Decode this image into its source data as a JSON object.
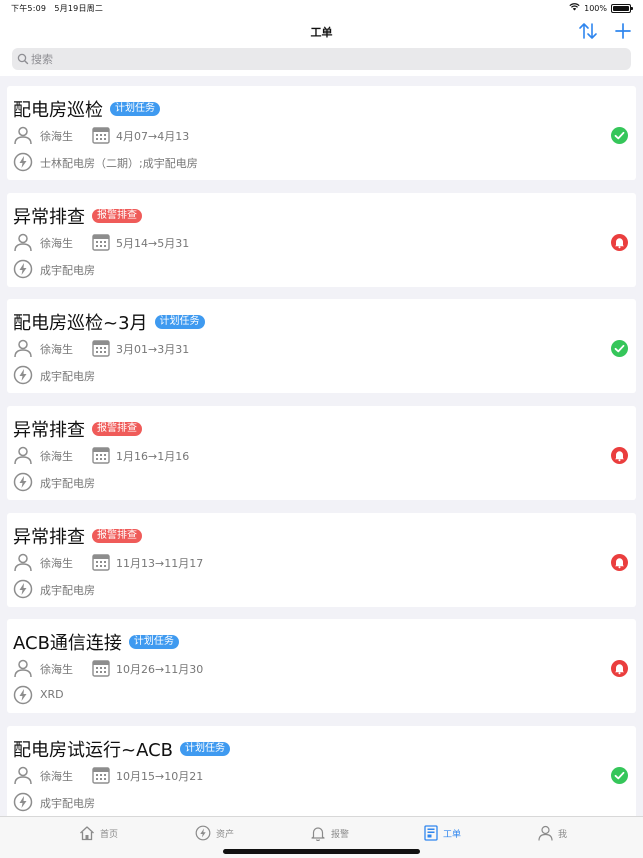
{
  "status_bar": {
    "time": "下午5:09",
    "date": "5月19日周二",
    "battery": "100%"
  },
  "nav": {
    "title": "工单"
  },
  "search": {
    "placeholder": "搜索"
  },
  "orders": [
    {
      "title": "配电房巡检",
      "tag": "计划任务",
      "tag_type": "plan",
      "assignee": "徐海生",
      "date_range": "4月07→4月13",
      "location": "士林配电房（二期）;成宇配电房",
      "status": "done"
    },
    {
      "title": "异常排查",
      "tag": "报警排查",
      "tag_type": "alarm",
      "assignee": "徐海生",
      "date_range": "5月14→5月31",
      "location": "成宇配电房",
      "status": "alarm"
    },
    {
      "title": "配电房巡检~3月",
      "tag": "计划任务",
      "tag_type": "plan",
      "assignee": "徐海生",
      "date_range": "3月01→3月31",
      "location": "成宇配电房",
      "status": "done"
    },
    {
      "title": "异常排查",
      "tag": "报警排查",
      "tag_type": "alarm",
      "assignee": "徐海生",
      "date_range": "1月16→1月16",
      "location": "成宇配电房",
      "status": "alarm"
    },
    {
      "title": "异常排查",
      "tag": "报警排查",
      "tag_type": "alarm",
      "assignee": "徐海生",
      "date_range": "11月13→11月17",
      "location": "成宇配电房",
      "status": "alarm"
    },
    {
      "title": "ACB通信连接",
      "tag": "计划任务",
      "tag_type": "plan",
      "assignee": "徐海生",
      "date_range": "10月26→11月30",
      "location": "XRD",
      "status": "alarm"
    },
    {
      "title": "配电房试运行~ACB",
      "tag": "计划任务",
      "tag_type": "plan",
      "assignee": "徐海生",
      "date_range": "10月15→10月21",
      "location": "成宇配电房",
      "status": "done"
    }
  ],
  "tabs": [
    {
      "label": "首页",
      "icon": "home-icon",
      "active": false
    },
    {
      "label": "资产",
      "icon": "bolt-icon",
      "active": false
    },
    {
      "label": "报警",
      "icon": "bell-icon",
      "active": false
    },
    {
      "label": "工单",
      "icon": "workorder-icon",
      "active": true
    },
    {
      "label": "我",
      "icon": "person-icon",
      "active": false
    }
  ],
  "colors": {
    "accent": "#2f86ee",
    "plan_tag": "#3f9af0",
    "alarm_tag": "#ef5b59",
    "done": "#35c65a",
    "alarm": "#ea3e3e"
  }
}
